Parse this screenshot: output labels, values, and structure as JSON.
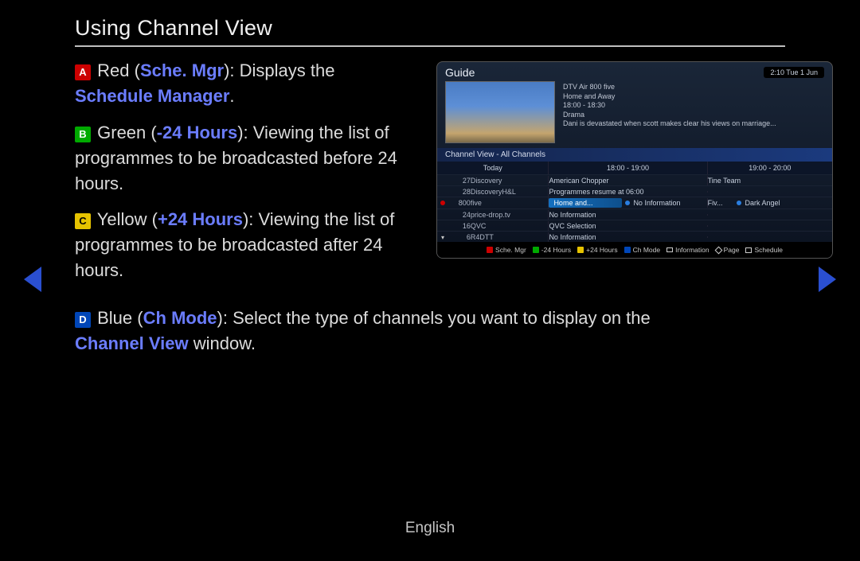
{
  "title": "Using Channel View",
  "items": {
    "A": {
      "color": "Red",
      "action": "Sche. Mgr",
      "desc1": "Displays the ",
      "link": "Schedule Manager",
      "desc2": "."
    },
    "B": {
      "color": "Green",
      "action": "-24 Hours",
      "desc": "Viewing the list of programmes to be broadcasted before 24 hours."
    },
    "C": {
      "color": "Yellow",
      "action": "+24 Hours",
      "desc": "Viewing the list of programmes to be broadcasted after 24 hours."
    },
    "D": {
      "color": "Blue",
      "action": "Ch Mode",
      "desc1": "Select the type of channels you want to display on the ",
      "link": "Channel View",
      "desc2": " window."
    }
  },
  "guide": {
    "title": "Guide",
    "clock": "2:10 Tue 1 Jun",
    "info": {
      "source": "DTV Air 800 five",
      "prog": "Home and Away",
      "time": "18:00 - 18:30",
      "genre": "Drama",
      "synopsis": "Dani is devastated when scott makes clear his views on marriage..."
    },
    "channelview_label": "Channel View - All Channels",
    "head": {
      "day": "Today",
      "t1": "18:00 - 19:00",
      "t2": "19:00 - 20:00"
    },
    "rows": [
      {
        "num": "27",
        "name": "Discovery",
        "p1": "American Chopper",
        "p2": "Tine Team"
      },
      {
        "num": "28",
        "name": "DiscoveryH&L",
        "p1": "Programmes resume at 06:00",
        "p2": ""
      },
      {
        "num": "800",
        "name": "five",
        "red": true,
        "p1": "Home and...",
        "p1b": "No Information",
        "p2": "Fiv...",
        "p2b": "Dark Angel",
        "highlight": true
      },
      {
        "num": "24",
        "name": "price-drop.tv",
        "p1": "No Information",
        "p2": ""
      },
      {
        "num": "16",
        "name": "QVC",
        "p1": "QVC Selection",
        "p2": ""
      },
      {
        "num": "6",
        "name": "R4DTT",
        "chev": true,
        "p1": "No Information",
        "p2": ""
      }
    ],
    "footer": {
      "a": "Sche. Mgr",
      "b": "-24 Hours",
      "c": "+24 Hours",
      "d": "Ch Mode",
      "info": "Information",
      "page": "Page",
      "sched": "Schedule"
    }
  },
  "footer_lang": "English"
}
